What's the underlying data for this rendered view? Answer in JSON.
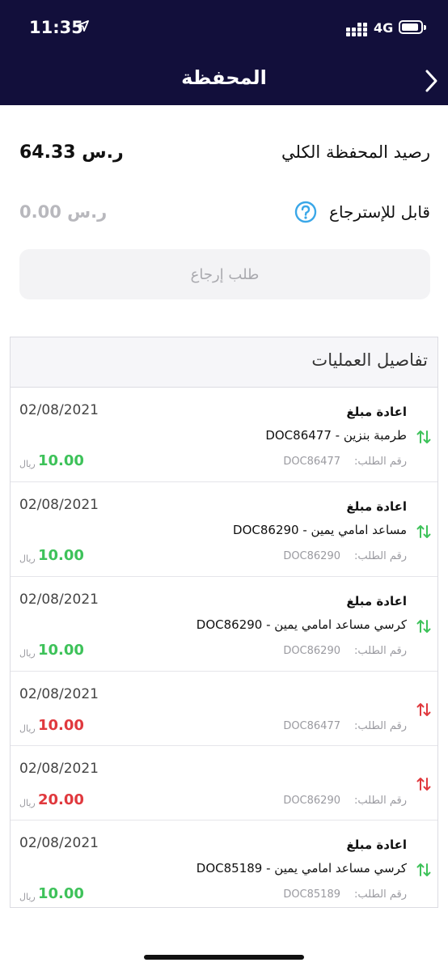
{
  "status_bar": {
    "time": "11:35",
    "network": "4G"
  },
  "header": {
    "title": "المحفظة"
  },
  "wallet": {
    "total_label": "رصيد المحفظة الكلي",
    "total_value": "64.33 ر.س",
    "refundable_label": "قابل للإسترجاع",
    "refundable_value": "0.00 ر.س",
    "refund_button": "طلب إرجاع"
  },
  "transactions": {
    "title": "تفاصيل العمليات",
    "order_label": "رقم الطلب:",
    "currency": "ريال",
    "items": [
      {
        "date": "02/08/2021",
        "type": "اعادة مبلغ",
        "desc": "طرمبة بنزين - DOC86477",
        "order": "DOC86477",
        "amount": "10.00",
        "direction": "in",
        "color": "#3ec25a"
      },
      {
        "date": "02/08/2021",
        "type": "اعادة مبلغ",
        "desc": "مساعد امامي يمين - DOC86290",
        "order": "DOC86290",
        "amount": "10.00",
        "direction": "in",
        "color": "#3ec25a"
      },
      {
        "date": "02/08/2021",
        "type": "اعادة مبلغ",
        "desc": "كرسي مساعد امامي يمين - DOC86290",
        "order": "DOC86290",
        "amount": "10.00",
        "direction": "in",
        "color": "#3ec25a"
      },
      {
        "date": "02/08/2021",
        "type": "",
        "desc": "",
        "order": "DOC86477",
        "amount": "10.00",
        "direction": "out",
        "color": "#e0393e"
      },
      {
        "date": "02/08/2021",
        "type": "",
        "desc": "",
        "order": "DOC86290",
        "amount": "20.00",
        "direction": "out",
        "color": "#e0393e"
      },
      {
        "date": "02/08/2021",
        "type": "اعادة مبلغ",
        "desc": "كرسي مساعد امامي يمين - DOC85189",
        "order": "DOC85189",
        "amount": "10.00",
        "direction": "in",
        "color": "#3ec25a"
      }
    ]
  },
  "icons": [
    "location-arrow-icon",
    "signal-icon",
    "battery-icon",
    "chevron-right-icon",
    "help-circle-icon",
    "transfer-arrows-icon"
  ]
}
